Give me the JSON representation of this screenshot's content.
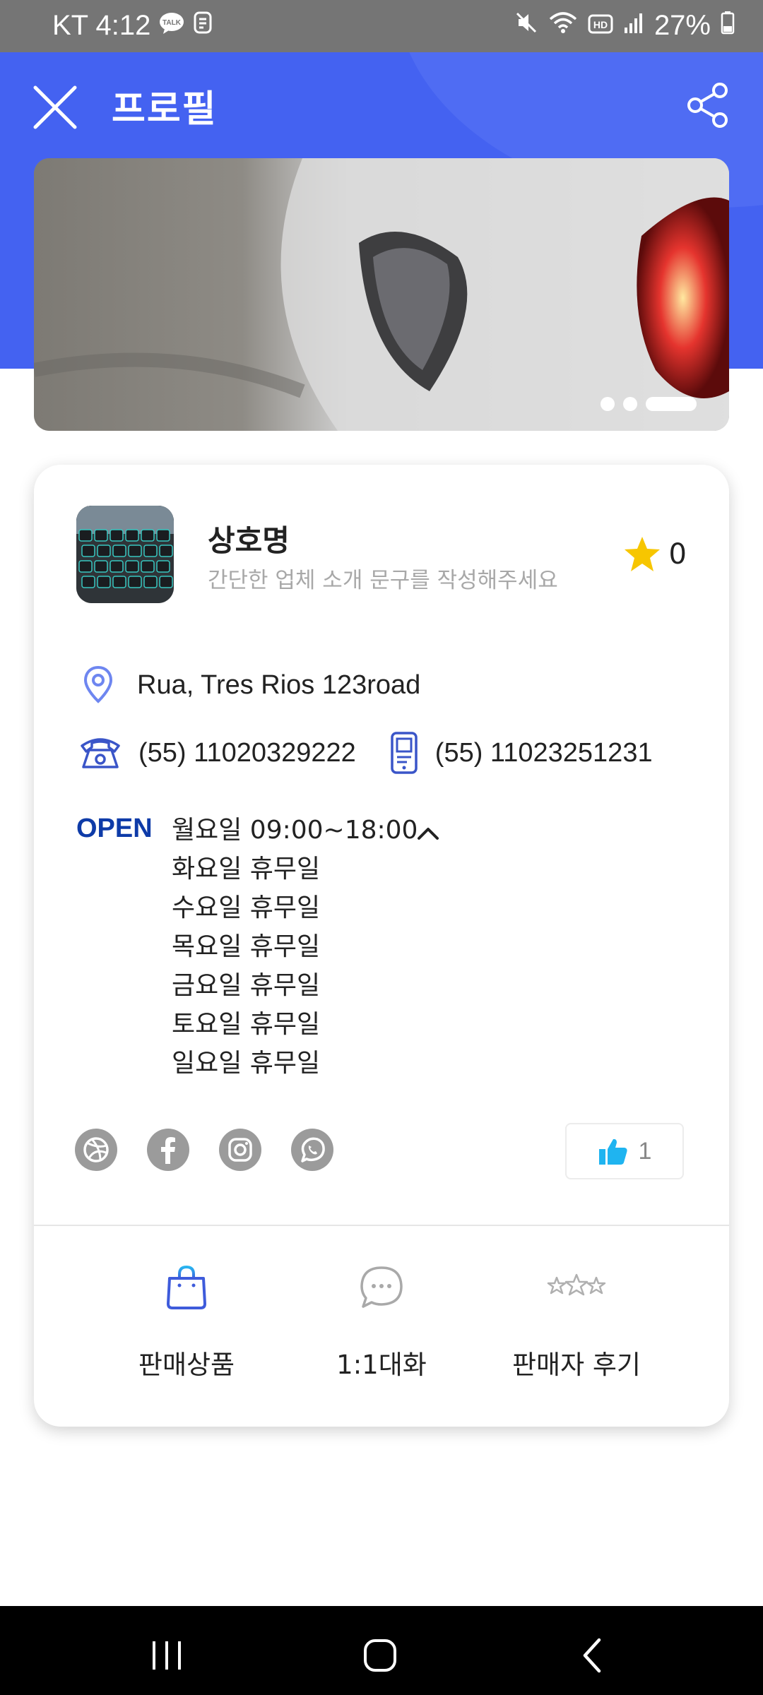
{
  "status_bar": {
    "carrier_time": "KT 4:12",
    "battery": "27%",
    "icons": [
      "kakaotalk-icon",
      "nfc-icon",
      "mute-icon",
      "wifi-icon",
      "hd-icon",
      "signal-icon",
      "battery-icon"
    ]
  },
  "header": {
    "title": "프로필",
    "close_icon": "close-icon",
    "share_icon": "share-icon"
  },
  "banner": {
    "slide_count": 3,
    "active_index": 2
  },
  "profile": {
    "name": "상호명",
    "description": "간단한 업체 소개 문구를 작성해주세요",
    "rating": "0",
    "address": "Rua, Tres Rios 123road",
    "phone": "(55) 11020329222",
    "mobile": "(55) 11023251231"
  },
  "hours": {
    "open_label": "OPEN",
    "lines": [
      "월요일 09:00~18:00",
      "화요일 휴무일",
      "수요일 휴무일",
      "목요일 휴무일",
      "금요일 휴무일",
      "토요일 휴무일",
      "일요일 휴무일"
    ]
  },
  "social": [
    "dribbble-icon",
    "facebook-icon",
    "instagram-icon",
    "whatsapp-icon"
  ],
  "likes": {
    "count": "1"
  },
  "tabs": [
    {
      "label": "판매상품",
      "icon": "shopping-bag-icon"
    },
    {
      "label": "1:1대화",
      "icon": "chat-bubble-icon"
    },
    {
      "label": "판매자 후기",
      "icon": "stars-icon"
    }
  ],
  "colors": {
    "header_bg": "#4462F1",
    "accent_blue": "#0E3BA8",
    "star_yellow": "#F7C600",
    "like_blue": "#1FB4F0",
    "social_gray": "#9B9B9B"
  }
}
